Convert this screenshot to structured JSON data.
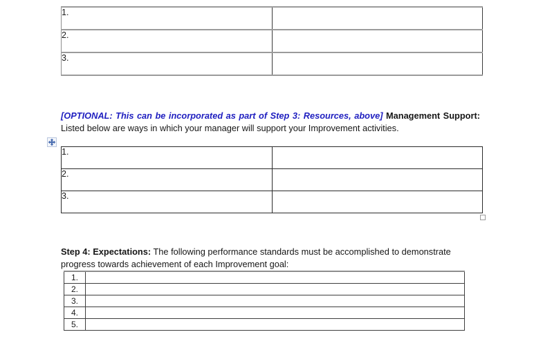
{
  "document": {
    "type": "performance-improvement-plan-form",
    "background_color": "#ffffff",
    "text_color": "#161616",
    "optional_note_color": "#2020c0"
  },
  "tables": {
    "goals_top": {
      "name": "goals-table",
      "rows": [
        {
          "number": "1.",
          "value": ""
        },
        {
          "number": "2.",
          "value": ""
        },
        {
          "number": "3.",
          "value": ""
        }
      ]
    },
    "management_support": {
      "name": "management-support-table",
      "rows": [
        {
          "number": "1.",
          "value": ""
        },
        {
          "number": "2.",
          "value": ""
        },
        {
          "number": "3.",
          "value": ""
        }
      ]
    },
    "expectations": {
      "name": "expectations-table",
      "rows": [
        {
          "number": "1.",
          "value": ""
        },
        {
          "number": "2.",
          "value": ""
        },
        {
          "number": "3.",
          "value": ""
        },
        {
          "number": "4.",
          "value": ""
        },
        {
          "number": "5.",
          "value": ""
        }
      ]
    }
  },
  "paragraphs": {
    "management_support": {
      "optional_note": "[OPTIONAL:  This can be incorporated as part of Step 3: Resources, above]",
      "heading": "Management Support:",
      "body": "   Listed below are ways in which your manager will support your Improvement activities."
    },
    "step4": {
      "heading": "Step 4:  Expectations:",
      "body": " The following performance standards must be accomplished to demonstrate progress towards achievement of each Improvement goal:"
    }
  },
  "handles": {
    "table_move": "table-move-handle-icon",
    "table_resize": "table-resize-handle-icon"
  }
}
